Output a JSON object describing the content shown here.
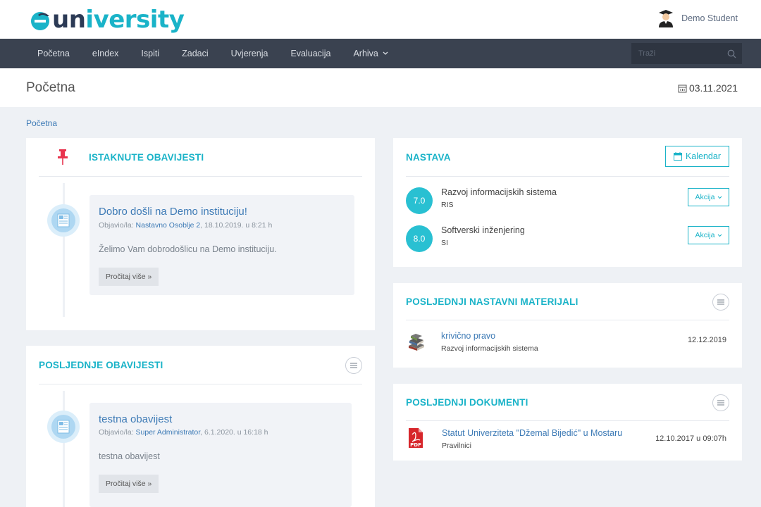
{
  "header": {
    "logo": {
      "e": "e",
      "un": "un",
      "iversity": "iversity"
    },
    "user_name": "Demo Student"
  },
  "nav": {
    "items": [
      "Početna",
      "eIndex",
      "Ispiti",
      "Zadaci",
      "Uvjerenja",
      "Evaluacija",
      "Arhiva"
    ],
    "search_placeholder": "Traži"
  },
  "page": {
    "title": "Početna",
    "date": "03.11.2021",
    "breadcrumb": "Početna"
  },
  "istaknute": {
    "title": "ISTAKNUTE OBAVIJESTI",
    "post": {
      "title": "Dobro došli na Demo instituciju!",
      "meta_prefix": "Objavio/la: ",
      "author": "Nastavno Osoblje 2",
      "meta_date": ", 18.10.2019. u 8:21 h",
      "text": "Želimo Vam dobrodošlicu na Demo instituciju.",
      "read_more": "Pročitaj više »"
    }
  },
  "posljednje": {
    "title": "POSLJEDNJE OBAVIJESTI",
    "post": {
      "title": "testna obavijest",
      "meta_prefix": "Objavio/la: ",
      "author": "Super Administrator",
      "meta_date": ", 6.1.2020. u 16:18 h",
      "text": "testna obavijest",
      "read_more": "Pročitaj više »"
    }
  },
  "nastava": {
    "title": "NASTAVA",
    "calendar_label": "Kalendar",
    "courses": [
      {
        "grade": "7.0",
        "name": "Razvoj informacijskih sistema",
        "code": "RIS",
        "action": "Akcija"
      },
      {
        "grade": "8.0",
        "name": "Softverski inženjering",
        "code": "SI",
        "action": "Akcija"
      }
    ]
  },
  "materijali": {
    "title": "POSLJEDNJI NASTAVNI MATERIJALI",
    "items": [
      {
        "title": "krivično pravo",
        "course": "Razvoj informacijskih sistema",
        "date": "12.12.2019"
      }
    ]
  },
  "dokumenti": {
    "title": "POSLJEDNJI DOKUMENTI",
    "items": [
      {
        "title": "Statut Univerziteta \"Džemal Bijedić\" u Mostaru",
        "category": "Pravilnici",
        "date": "12.10.2017 u 09:07h",
        "badge": "PDF"
      }
    ]
  },
  "colors": {
    "accent": "#1ab3c8",
    "link": "#3e7bb6",
    "nav": "#3a4250",
    "grade": "#29c0d2"
  }
}
